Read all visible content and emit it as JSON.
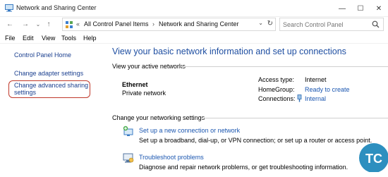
{
  "window": {
    "title": "Network and Sharing Center",
    "minimize_glyph": "—",
    "maximize_glyph": "☐",
    "close_glyph": "✕"
  },
  "nav": {
    "back_glyph": "←",
    "forward_glyph": "→",
    "recent_glyph": "⌄",
    "up_glyph": "↑"
  },
  "address": {
    "chevron_left": "«",
    "crumbs": [
      "All Control Panel Items",
      "Network and Sharing Center"
    ],
    "separator": "›",
    "dropdown_glyph": "⌄",
    "refresh_glyph": "↻"
  },
  "search": {
    "placeholder": "Search Control Panel"
  },
  "menu": [
    "File",
    "Edit",
    "View",
    "Tools",
    "Help"
  ],
  "sidebar": {
    "items": [
      {
        "label": "Control Panel Home"
      },
      {
        "label": "Change adapter settings"
      },
      {
        "label_line1": "Change advanced sharing",
        "label_line2": "settings"
      }
    ]
  },
  "main": {
    "heading": "View your basic network information and set up connections",
    "active_networks_label": "View your active networks",
    "network": {
      "name": "Ethernet",
      "type": "Private network",
      "access_type_label": "Access type:",
      "access_type_value": "Internet",
      "homegroup_label": "HomeGroup:",
      "homegroup_value": "Ready to create",
      "connections_label": "Connections:",
      "connections_value": "Internal"
    },
    "change_settings_label": "Change your networking settings",
    "tasks": [
      {
        "link": "Set up a new connection or network",
        "desc": "Set up a broadband, dial-up, or VPN connection; or set up a router or access point."
      },
      {
        "link": "Troubleshoot problems",
        "desc": "Diagnose and repair network problems, or get troubleshooting information."
      }
    ]
  },
  "colors": {
    "link": "#1a56b0",
    "heading": "#1e4ea1",
    "highlight_border": "#c0392b",
    "watermark": "#2d8fbf"
  },
  "watermark": {
    "text": "TC"
  }
}
